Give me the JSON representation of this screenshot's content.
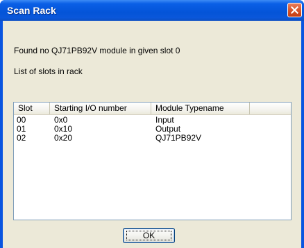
{
  "window": {
    "title": "Scan Rack"
  },
  "message": "Found no QJ71PB92V module in given slot 0",
  "list_label": "List of slots in rack",
  "table": {
    "columns": [
      "Slot",
      "Starting I/O number",
      "Module Typename"
    ],
    "rows": [
      [
        "00",
        "0x0",
        "Input"
      ],
      [
        "01",
        "0x10",
        "Output"
      ],
      [
        "02",
        "0x20",
        "QJ71PB92V"
      ]
    ]
  },
  "buttons": {
    "ok_label": "OK"
  },
  "colors": {
    "titlebar": "#0454d8",
    "dialog_bg": "#ece9d8",
    "close_button": "#d8552b"
  },
  "icons": {
    "close": "close-icon"
  }
}
